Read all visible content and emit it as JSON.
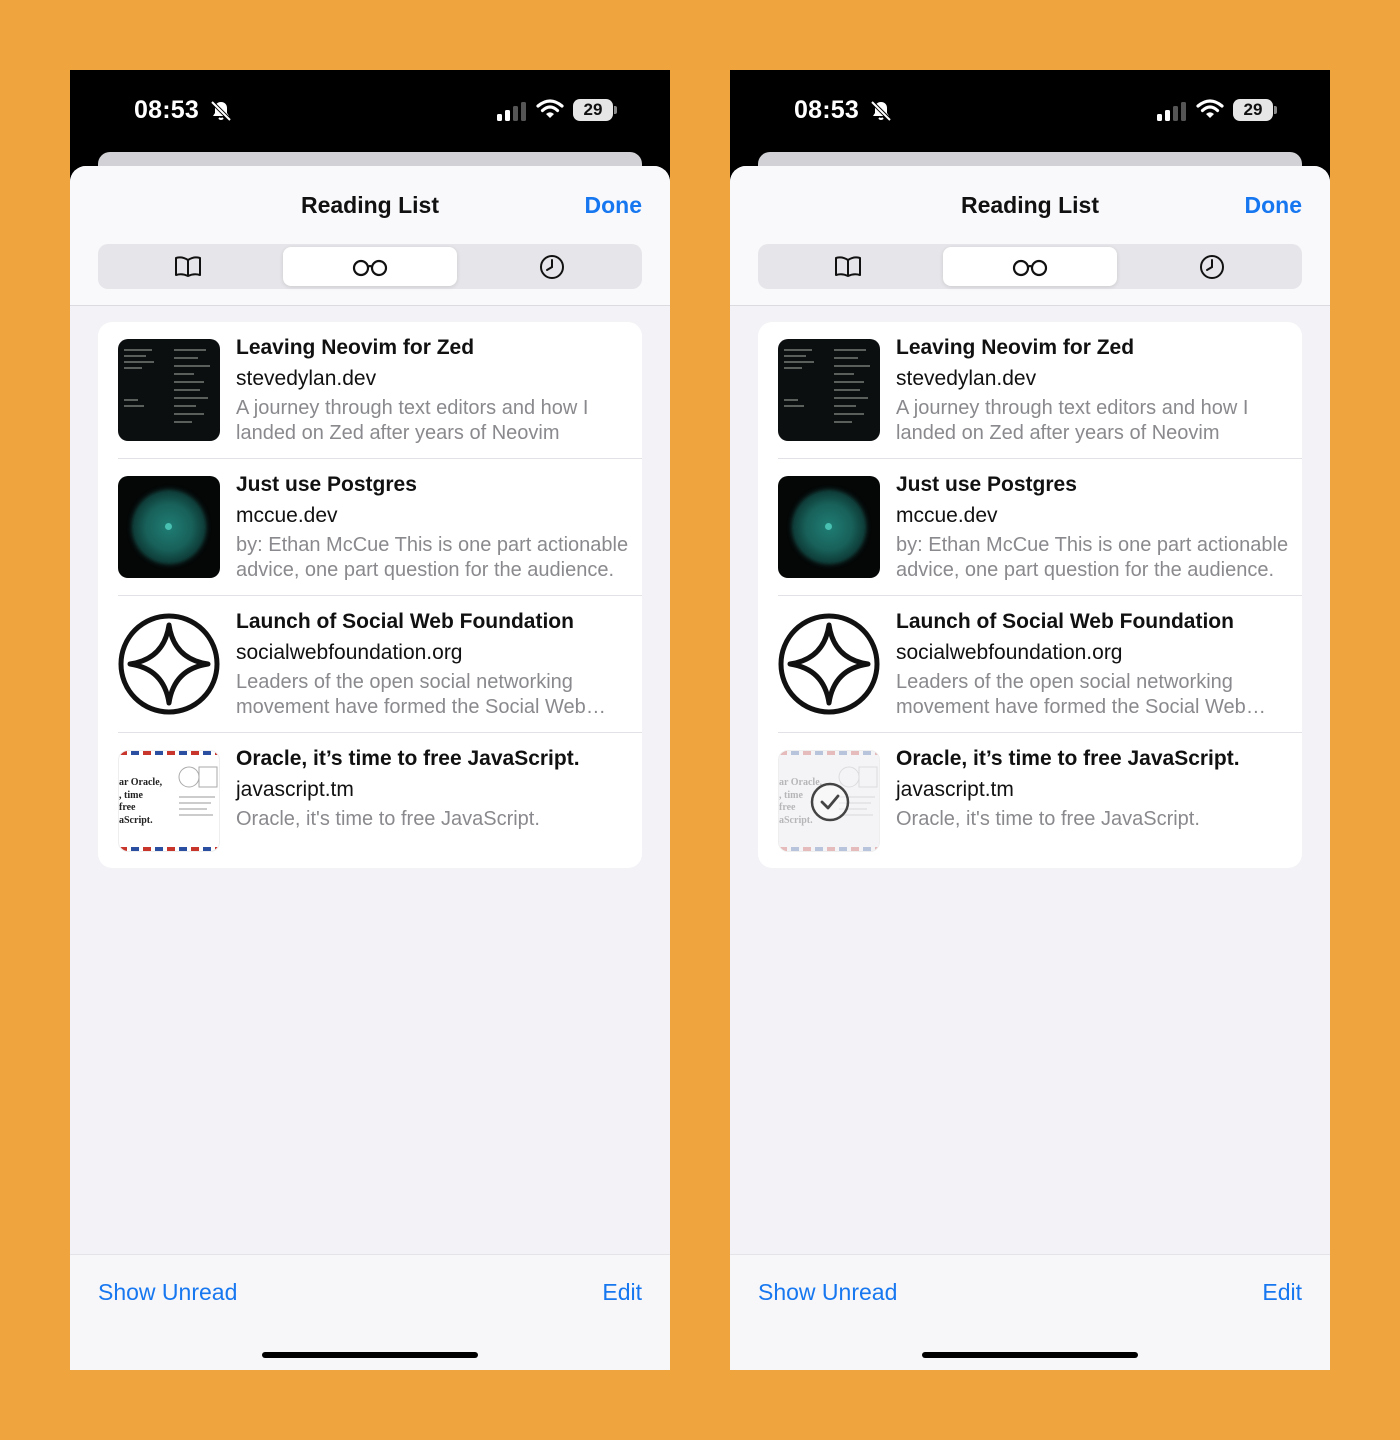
{
  "status_bar": {
    "time": "08:53",
    "battery": "29"
  },
  "header": {
    "title": "Reading List",
    "done_label": "Done"
  },
  "tabs": [
    {
      "name": "Bookmarks",
      "icon": "book-icon"
    },
    {
      "name": "Reading List",
      "icon": "glasses-icon",
      "selected": true
    },
    {
      "name": "History",
      "icon": "clock-icon"
    }
  ],
  "items": [
    {
      "title": "Leaving Neovim for Zed",
      "domain": "stevedylan.dev",
      "description": "A journey through text editors and how I landed on Zed after years of Neovim",
      "thumb": "code-editor-screenshot"
    },
    {
      "title": "Just use Postgres",
      "domain": "mccue.dev",
      "description": "by: Ethan McCue This is one part actionable advice, one part question for the audience.",
      "thumb": "teal-orb"
    },
    {
      "title": "Launch of Social Web Foundation",
      "domain": "socialwebfoundation.org",
      "description": "Leaders of the open social networking movement have formed the Social Web Foundation",
      "thumb": "four-point-star-logo"
    },
    {
      "title": "Oracle, it’s time to free JavaScript.",
      "domain": "javascript.tm",
      "description": "Oracle, it's time to free JavaScript.",
      "thumb": "airmail-letter",
      "thumb_text": [
        "ar Oracle,",
        ", time",
        "free",
        "aScript."
      ]
    }
  ],
  "footer": {
    "show_unread_label": "Show Unread",
    "edit_label": "Edit"
  },
  "colors": {
    "accent": "#1677f0",
    "background": "#f0a43e"
  },
  "right_screen": {
    "last_item_marked_read": true,
    "read_icon": "checkmark-circle-icon"
  }
}
